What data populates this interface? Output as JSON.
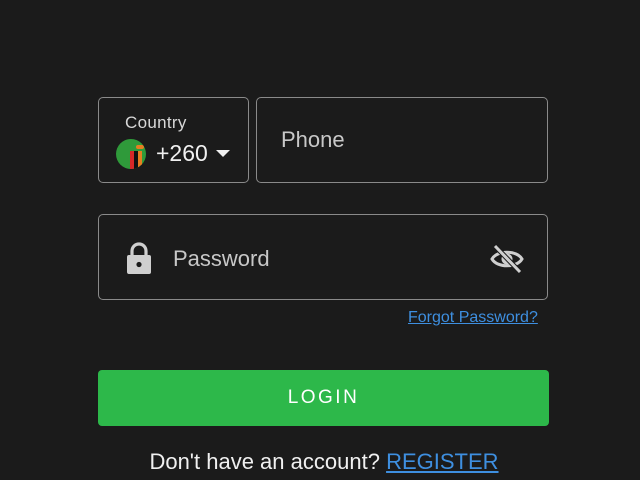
{
  "country_selector": {
    "label": "Country",
    "dial_code": "+260",
    "flag_icon": "zambia-flag-icon",
    "caret_icon": "caret-down-icon"
  },
  "phone": {
    "placeholder": "Phone",
    "value": ""
  },
  "password": {
    "placeholder": "Password",
    "value": "",
    "lock_icon": "lock-icon",
    "visibility_icon": "eye-off-icon"
  },
  "forgot_password": {
    "label": "Forgot Password?"
  },
  "login": {
    "label": "LOGIN"
  },
  "register": {
    "prompt": "Don't have an account?",
    "link_label": "REGISTER"
  },
  "colors": {
    "background": "#1b1b1b",
    "border": "#8a8a8a",
    "accent_green": "#2db84a",
    "link_blue": "#3e8fe0"
  }
}
